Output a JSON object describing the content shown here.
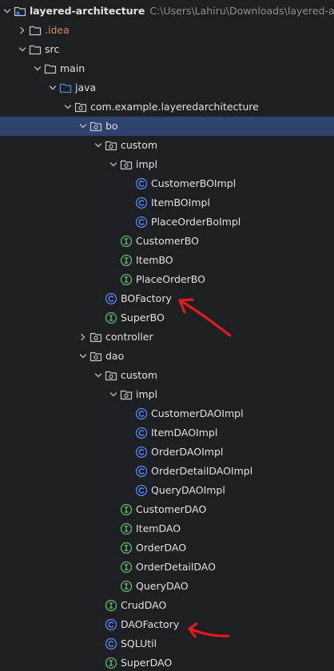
{
  "colors": {
    "background": "#1e1f22",
    "selection": "#2e436e",
    "text": "#dfe1e5",
    "muted": "#8c8f94",
    "excluded": "#d5895b",
    "class_icon": "#548af7",
    "interface_icon": "#5fb865",
    "annotation_arrow": "#e11b1b"
  },
  "tree": [
    {
      "label": "layered-architecture",
      "path": "C:\\Users\\Lahiru\\Downloads\\layered-arch",
      "icon": "module-folder-icon",
      "level": 0,
      "expanded": true,
      "bold": true
    },
    {
      "label": ".idea",
      "icon": "folder-icon",
      "level": 1,
      "expanded": false,
      "excluded": true
    },
    {
      "label": "src",
      "icon": "folder-icon",
      "level": 1,
      "expanded": true
    },
    {
      "label": "main",
      "icon": "folder-icon",
      "level": 2,
      "expanded": true
    },
    {
      "label": "java",
      "icon": "source-folder-icon",
      "level": 3,
      "expanded": true
    },
    {
      "label": "com.example.layeredarchitecture",
      "icon": "package-icon",
      "level": 4,
      "expanded": true
    },
    {
      "label": "bo",
      "icon": "package-icon",
      "level": 5,
      "expanded": true,
      "selected": true
    },
    {
      "label": "custom",
      "icon": "package-icon",
      "level": 6,
      "expanded": true
    },
    {
      "label": "impl",
      "icon": "package-icon",
      "level": 7,
      "expanded": true
    },
    {
      "label": "CustomerBOImpl",
      "icon": "class-icon",
      "level": 8
    },
    {
      "label": "ItemBOImpl",
      "icon": "class-icon",
      "level": 8
    },
    {
      "label": "PlaceOrderBoImpl",
      "icon": "class-icon",
      "level": 8
    },
    {
      "label": "CustomerBO",
      "icon": "interface-icon",
      "level": 7
    },
    {
      "label": "ItemBO",
      "icon": "interface-icon",
      "level": 7
    },
    {
      "label": "PlaceOrderBO",
      "icon": "interface-icon",
      "level": 7
    },
    {
      "label": "BOFactory",
      "icon": "class-icon",
      "level": 6
    },
    {
      "label": "SuperBO",
      "icon": "interface-icon",
      "level": 6
    },
    {
      "label": "controller",
      "icon": "package-icon",
      "level": 5,
      "expanded": false
    },
    {
      "label": "dao",
      "icon": "package-icon",
      "level": 5,
      "expanded": true
    },
    {
      "label": "custom",
      "icon": "package-icon",
      "level": 6,
      "expanded": true
    },
    {
      "label": "impl",
      "icon": "package-icon",
      "level": 7,
      "expanded": true
    },
    {
      "label": "CustomerDAOImpl",
      "icon": "class-icon",
      "level": 8
    },
    {
      "label": "ItemDAOImpl",
      "icon": "class-icon",
      "level": 8
    },
    {
      "label": "OrderDAOImpl",
      "icon": "class-icon",
      "level": 8
    },
    {
      "label": "OrderDetailDAOImpl",
      "icon": "class-icon",
      "level": 8
    },
    {
      "label": "QueryDAOImpl",
      "icon": "class-icon",
      "level": 8
    },
    {
      "label": "CustomerDAO",
      "icon": "interface-icon",
      "level": 7
    },
    {
      "label": "ItemDAO",
      "icon": "interface-icon",
      "level": 7
    },
    {
      "label": "OrderDAO",
      "icon": "interface-icon",
      "level": 7
    },
    {
      "label": "OrderDetailDAO",
      "icon": "interface-icon",
      "level": 7
    },
    {
      "label": "QueryDAO",
      "icon": "interface-icon",
      "level": 7
    },
    {
      "label": "CrudDAO",
      "icon": "interface-icon",
      "level": 6
    },
    {
      "label": "DAOFactory",
      "icon": "class-icon",
      "level": 6
    },
    {
      "label": "SQLUtil",
      "icon": "class-icon",
      "level": 6
    },
    {
      "label": "SuperDAO",
      "icon": "interface-icon",
      "level": 6
    }
  ],
  "annotations": [
    {
      "name": "red-arrow-annotation",
      "points_to": "BOFactory"
    },
    {
      "name": "red-arrow-annotation",
      "points_to": "DAOFactory"
    }
  ]
}
